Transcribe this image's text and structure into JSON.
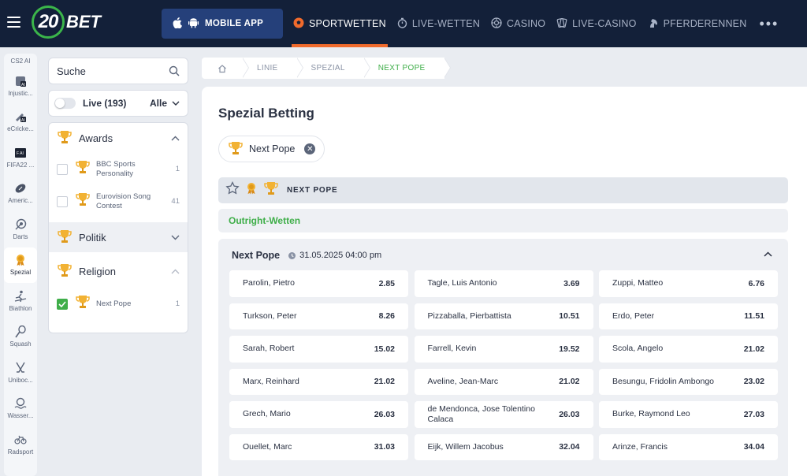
{
  "brand": {
    "logo_number": "20",
    "logo_text": "BET"
  },
  "header": {
    "mobile_app": "MOBILE APP",
    "nav": [
      {
        "label": "SPORTWETTEN",
        "icon": "soccer-ball-icon",
        "active": true
      },
      {
        "label": "LIVE-WETTEN",
        "icon": "stopwatch-icon",
        "active": false
      },
      {
        "label": "CASINO",
        "icon": "casino-chip-icon",
        "active": false
      },
      {
        "label": "LIVE-CASINO",
        "icon": "cards-icon",
        "active": false
      },
      {
        "label": "PFERDERENNEN",
        "icon": "horse-icon",
        "active": false
      }
    ],
    "more": "•••"
  },
  "rail": {
    "top_label": "CS2 AI",
    "items": [
      {
        "label": "Injustic...",
        "icon": "ai-fighter-icon"
      },
      {
        "label": "eCricke...",
        "icon": "ai-cricket-icon"
      },
      {
        "label": "FIFA22 ...",
        "icon": "ai-fifa-icon"
      },
      {
        "label": "Americ...",
        "icon": "american-football-icon"
      },
      {
        "label": "Darts",
        "icon": "darts-icon"
      },
      {
        "label": "Spezial",
        "icon": "special-medal-icon",
        "active": true
      },
      {
        "label": "Biathlon",
        "icon": "biathlon-icon"
      },
      {
        "label": "Squash",
        "icon": "squash-icon"
      },
      {
        "label": "Uniboc...",
        "icon": "unihockey-icon"
      },
      {
        "label": "Wasser...",
        "icon": "waterpolo-icon"
      },
      {
        "label": "Radsport",
        "icon": "bicycle-icon"
      }
    ]
  },
  "search": {
    "placeholder": "Suche"
  },
  "live_filter": {
    "label": "Live (193)",
    "select": "Alle"
  },
  "categories": {
    "awards": {
      "label": "Awards",
      "items": [
        {
          "name": "BBC Sports Personality",
          "count": "1"
        },
        {
          "name": "Eurovision Song Contest",
          "count": "41"
        }
      ]
    },
    "politik": {
      "label": "Politik"
    },
    "religion": {
      "label": "Religion",
      "items": [
        {
          "name": "Next Pope",
          "count": "1"
        }
      ]
    }
  },
  "breadcrumb": [
    "LINIE",
    "SPEZIAL",
    "NEXT POPE"
  ],
  "main": {
    "title": "Spezial Betting",
    "chip": "Next Pope",
    "category_bar": "NEXT POPE",
    "section": "Outright-Wetten",
    "market": {
      "title": "Next Pope",
      "date": "31.05.2025 04:00 pm",
      "odds": [
        {
          "name": "Parolin, Pietro",
          "value": "2.85"
        },
        {
          "name": "Tagle, Luis Antonio",
          "value": "3.69"
        },
        {
          "name": "Zuppi, Matteo",
          "value": "6.76"
        },
        {
          "name": "Turkson, Peter",
          "value": "8.26"
        },
        {
          "name": "Pizzaballa, Pierbattista",
          "value": "10.51"
        },
        {
          "name": "Erdo, Peter",
          "value": "11.51"
        },
        {
          "name": "Sarah, Robert",
          "value": "15.02"
        },
        {
          "name": "Farrell, Kevin",
          "value": "19.52"
        },
        {
          "name": "Scola, Angelo",
          "value": "21.02"
        },
        {
          "name": "Marx, Reinhard",
          "value": "21.02"
        },
        {
          "name": "Aveline, Jean-Marc",
          "value": "21.02"
        },
        {
          "name": "Besungu, Fridolin Ambongo",
          "value": "23.02"
        },
        {
          "name": "Grech, Mario",
          "value": "26.03"
        },
        {
          "name": "de Mendonca, Jose Tolentino Calaca",
          "value": "26.03"
        },
        {
          "name": "Burke, Raymond Leo",
          "value": "27.03"
        },
        {
          "name": "Ouellet, Marc",
          "value": "31.03"
        },
        {
          "name": "Eijk, Willem Jacobus",
          "value": "32.04"
        },
        {
          "name": "Arinze, Francis",
          "value": "34.04"
        }
      ]
    }
  },
  "colors": {
    "header_bg": "#132039",
    "accent_orange": "#f06a2c",
    "accent_green": "#3fae49",
    "mobile_btn": "#25407a"
  }
}
